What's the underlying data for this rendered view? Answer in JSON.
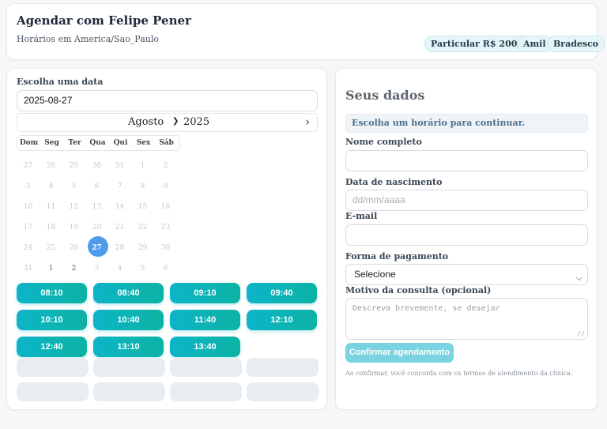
{
  "header": {
    "title": "Agendar com Felipe Pener",
    "subtitle": "Horários em America/Sao_Paulo",
    "badges": [
      "Particular R$ 200,00",
      "Amil",
      "Bradesco"
    ]
  },
  "calendar": {
    "label": "Escolha uma data",
    "date_value": "2025-08-27",
    "month": "Agosto",
    "year": "2025",
    "weekdays": [
      "Dom",
      "Seg",
      "Ter",
      "Qua",
      "Qui",
      "Sex",
      "Sáb"
    ],
    "weeks": [
      [
        "27",
        "28",
        "29",
        "30",
        "31",
        "1",
        "2"
      ],
      [
        "3",
        "4",
        "5",
        "6",
        "7",
        "8",
        "9"
      ],
      [
        "10",
        "11",
        "12",
        "13",
        "14",
        "15",
        "16"
      ],
      [
        "17",
        "18",
        "19",
        "20",
        "21",
        "22",
        "23"
      ],
      [
        "24",
        "25",
        "26",
        "27",
        "28",
        "29",
        "30"
      ],
      [
        "31",
        "1",
        "2",
        "3",
        "4",
        "5",
        "6"
      ]
    ],
    "selected_day": "27"
  },
  "slots": [
    "08:10",
    "08:40",
    "09:10",
    "09:40",
    "10:10",
    "10:40",
    "11:40",
    "12:10",
    "12:40",
    "13:10",
    "13:40"
  ],
  "form": {
    "title": "Seus dados",
    "alert": "Escolha um horário para continuar.",
    "name_label": "Nome completo",
    "name_value": "",
    "dob_label": "Data de nascimento",
    "dob_placeholder": "dd/mm/aaaa",
    "email_label": "E-mail",
    "email_value": "",
    "payment_label": "Forma de pagamento",
    "payment_value": "Selecione",
    "reason_label": "Motivo da consulta (opcional)",
    "reason_placeholder": "Descreva brevemente, se desejar",
    "confirm_label": "Confirmar agendamento",
    "disclaimer": "Ao confirmar, você concorda com os termos de atendimento da clínica."
  },
  "colors": {
    "slot_gradient_start": "#0db4c9",
    "slot_gradient_end": "#0bb3a3",
    "selected_day": "#4e9bea",
    "confirm_disabled": "#7ad3e0"
  }
}
